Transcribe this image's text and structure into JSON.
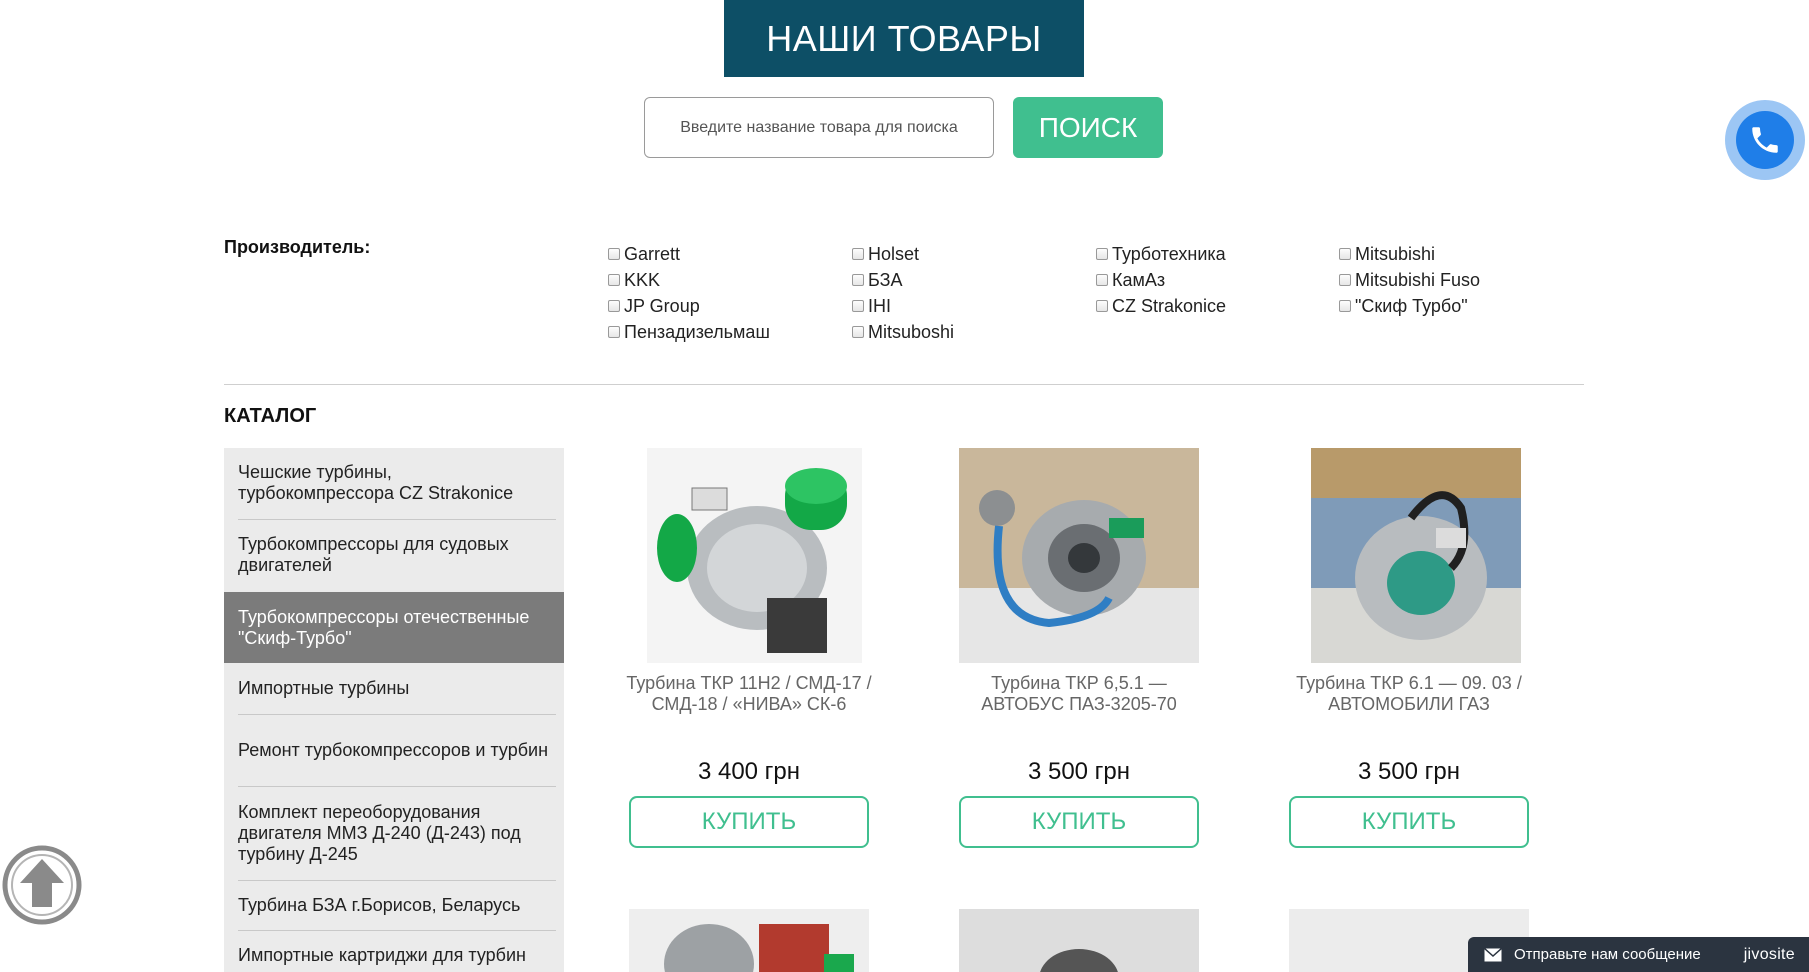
{
  "header": {
    "title": "НАШИ ТОВАРЫ"
  },
  "search": {
    "placeholder": "Введите название товара для поиска",
    "value": "",
    "button_label": "ПОИСК"
  },
  "call_button": {
    "icon": "phone-icon"
  },
  "filters": {
    "label": "Производитель:",
    "columns": [
      [
        "Garrett",
        "KKK",
        "JP Group",
        "Пензадизельмаш"
      ],
      [
        "Holset",
        "БЗА",
        "IHI",
        "Mitsuboshi"
      ],
      [
        "Турботехника",
        "КамАз",
        "CZ Strakonice"
      ],
      [
        "Mitsubishi",
        "Mitsubishi Fuso",
        "\"Скиф Турбо\""
      ]
    ]
  },
  "catalog": {
    "title": "КАТАЛОГ",
    "items": [
      {
        "label": "Чешские турбины, турбокомпрессора CZ Strakonice",
        "active": false
      },
      {
        "label": "Турбокомпрессоры для судовых двигателей",
        "active": false
      },
      {
        "label": "Турбокомпрессоры отечественные \"Скиф-Турбо\"",
        "active": true
      },
      {
        "label": "Импортные турбины",
        "active": false
      },
      {
        "label": "Ремонт турбокомпрессоров и турбин",
        "active": false
      },
      {
        "label": "Комплект переоборудования двигателя ММЗ Д-240 (Д-243) под турбину Д-245",
        "active": false
      },
      {
        "label": "Турбина БЗА г.Борисов, Беларусь",
        "active": false
      },
      {
        "label": "Импортные картриджи для турбин",
        "active": false
      }
    ]
  },
  "products": [
    {
      "title": "Турбина ТКР 11Н2 / СМД-17 / СМД-18 / «НИВА» СК-6",
      "price": "3 400 грн",
      "buy_label": "КУПИТЬ"
    },
    {
      "title": "Турбина ТКР 6,5.1 — АВТОБУС ПАЗ-3205-70",
      "price": "3 500 грн",
      "buy_label": "КУПИТЬ"
    },
    {
      "title": "Турбина ТКР 6.1 — 09. 03 / АВТОМОБИЛИ ГАЗ",
      "price": "3 500 грн",
      "buy_label": "КУПИТЬ"
    }
  ],
  "scroll_top": {
    "icon": "arrow-up-circle-icon"
  },
  "chat": {
    "message": "Отправьте нам сообщение",
    "brand": "jivosite",
    "icon": "envelope-icon"
  },
  "colors": {
    "title_bg": "#0d4f66",
    "accent": "#40bf8f",
    "sidebar_bg": "#ebebeb",
    "sidebar_active": "#7b7b7b",
    "call_blue": "#1f7ee8",
    "chat_bg": "#2b3440"
  }
}
